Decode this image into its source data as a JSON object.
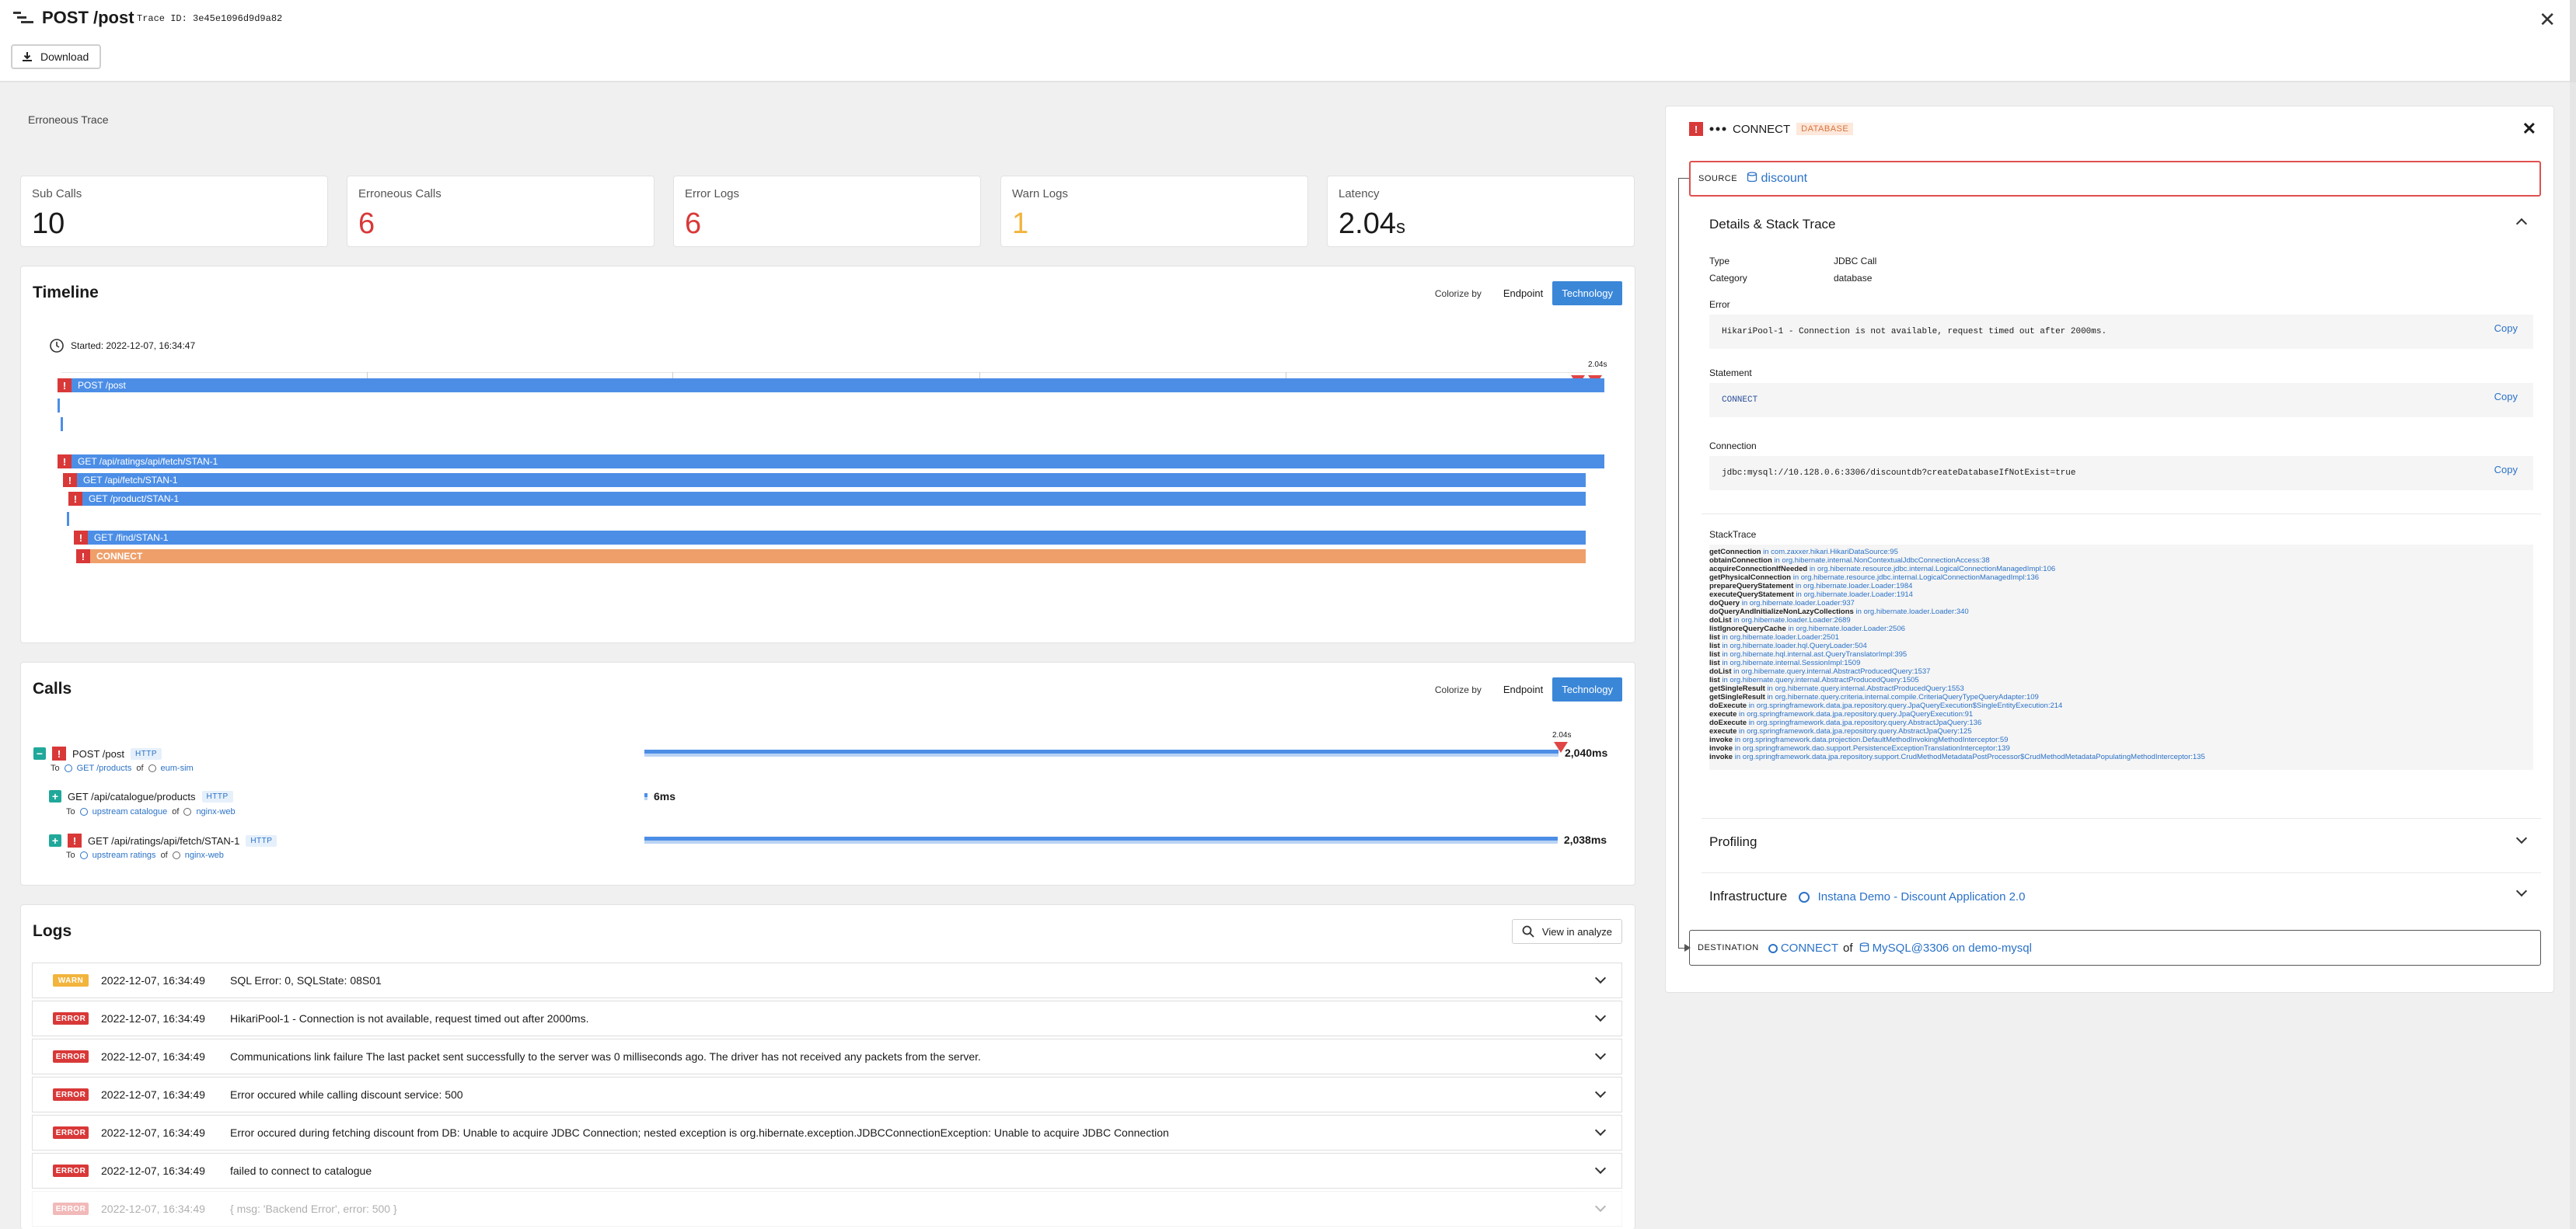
{
  "header": {
    "title": "POST /post",
    "trace_id": "Trace ID: 3e45e1096d9d9a82",
    "download_label": "Download",
    "close_glyph": "✕"
  },
  "main": {
    "erroneous_label": "Erroneous Trace",
    "stats": [
      {
        "label": "Sub Calls",
        "value": "10",
        "color": "#1a1a1a"
      },
      {
        "label": "Erroneous Calls",
        "value": "6",
        "color": "#d93838"
      },
      {
        "label": "Error Logs",
        "value": "6",
        "color": "#d93838"
      },
      {
        "label": "Warn Logs",
        "value": "1",
        "color": "#f2b43c"
      },
      {
        "label": "Latency",
        "value": "2.04",
        "unit": "s",
        "color": "#1a1a1a"
      }
    ],
    "timeline": {
      "title": "Timeline",
      "colorize_label": "Colorize by",
      "option_endpoint": "Endpoint",
      "option_technology": "Technology",
      "started": "Started: 2022-12-07, 16:34:47",
      "end_label": "2.04s",
      "spans": [
        {
          "label": "POST /post",
          "start": 0.0,
          "end": 1.0,
          "error": true,
          "color": "blue"
        },
        {
          "label": "GET /api/ratings/api/fetch/STAN-1",
          "start": 0.0,
          "end": 1.0,
          "error": true,
          "color": "blue"
        },
        {
          "label": "GET /api/fetch/STAN-1",
          "start": 0.002,
          "end": 0.988,
          "error": true,
          "color": "blue"
        },
        {
          "label": "GET /product/STAN-1",
          "start": 0.004,
          "end": 0.988,
          "error": true,
          "color": "blue"
        },
        {
          "label": "GET /find/STAN-1",
          "start": 0.006,
          "end": 0.988,
          "error": true,
          "color": "blue"
        },
        {
          "label": "CONNECT",
          "start": 0.006,
          "end": 0.988,
          "error": true,
          "color": "orange"
        }
      ]
    },
    "calls": {
      "title": "Calls",
      "colorize_label": "Colorize by",
      "option_endpoint": "Endpoint",
      "option_technology": "Technology",
      "end_label": "2.04s",
      "rows": [
        {
          "name": "POST /post",
          "tag": "HTTP",
          "to": "To",
          "target": "GET /products",
          "of": "of",
          "service": "eum-sim",
          "duration": "2,040ms",
          "toggle": "−",
          "error": true,
          "fraction": 1.0
        },
        {
          "name": "GET /api/catalogue/products",
          "tag": "HTTP",
          "to": "To",
          "target": "upstream catalogue",
          "of": "of",
          "service": "nginx-web",
          "duration": "6ms",
          "toggle": "+",
          "error": false,
          "fraction": 0.003
        },
        {
          "name": "GET /api/ratings/api/fetch/STAN-1",
          "tag": "HTTP",
          "to": "To",
          "target": "upstream ratings",
          "of": "of",
          "service": "nginx-web",
          "duration": "2,038ms",
          "toggle": "+",
          "error": true,
          "fraction": 0.999
        }
      ]
    },
    "logs": {
      "title": "Logs",
      "view_label": "View in analyze",
      "rows": [
        {
          "level": "WARN",
          "time": "2022-12-07, 16:34:49",
          "message": "SQL Error: 0, SQLState: 08S01"
        },
        {
          "level": "ERROR",
          "time": "2022-12-07, 16:34:49",
          "message": "HikariPool-1 - Connection is not available, request timed out after 2000ms."
        },
        {
          "level": "ERROR",
          "time": "2022-12-07, 16:34:49",
          "message": "Communications link failure The last packet sent successfully to the server was 0 milliseconds ago. The driver has not received any packets from the server."
        },
        {
          "level": "ERROR",
          "time": "2022-12-07, 16:34:49",
          "message": "Error occured while calling discount service: 500"
        },
        {
          "level": "ERROR",
          "time": "2022-12-07, 16:34:49",
          "message": "Error occured during fetching discount from DB: Unable to acquire JDBC Connection; nested exception is org.hibernate.exception.JDBCConnectionException: Unable to acquire JDBC Connection"
        },
        {
          "level": "ERROR",
          "time": "2022-12-07, 16:34:49",
          "message": "failed to connect to catalogue"
        },
        {
          "level": "ERROR",
          "time": "2022-12-07, 16:34:49",
          "message": "{ msg: 'Backend Error', error: 500 }"
        }
      ]
    }
  },
  "detail": {
    "title": "CONNECT",
    "tag": "DATABASE",
    "close": "✕",
    "source_label": "SOURCE",
    "source_value": "discount",
    "details_title": "Details & Stack Trace",
    "type_key": "Type",
    "type_value": "JDBC Call",
    "category_key": "Category",
    "category_value": "database",
    "error_label": "Error",
    "error_value": "HikariPool-1 - Connection is not available, request timed out after 2000ms.",
    "statement_label": "Statement",
    "statement_value": "CONNECT",
    "connection_label": "Connection",
    "connection_value": "jdbc:mysql://10.128.0.6:3306/discountdb?createDatabaseIfNotExist=true",
    "copy_label": "Copy",
    "stack_label": "StackTrace",
    "stack": [
      {
        "m": "getConnection",
        "p": "in com.zaxxer.hikari.HikariDataSource:95"
      },
      {
        "m": "obtainConnection",
        "p": "in org.hibernate.internal.NonContextualJdbcConnectionAccess:38"
      },
      {
        "m": "acquireConnectionIfNeeded",
        "p": "in org.hibernate.resource.jdbc.internal.LogicalConnectionManagedImpl:106"
      },
      {
        "m": "getPhysicalConnection",
        "p": "in org.hibernate.resource.jdbc.internal.LogicalConnectionManagedImpl:136"
      },
      {
        "m": "prepareQueryStatement",
        "p": "in org.hibernate.loader.Loader:1984"
      },
      {
        "m": "executeQueryStatement",
        "p": "in org.hibernate.loader.Loader:1914"
      },
      {
        "m": "doQuery",
        "p": "in org.hibernate.loader.Loader:937"
      },
      {
        "m": "doQueryAndInitializeNonLazyCollections",
        "p": "in org.hibernate.loader.Loader:340"
      },
      {
        "m": "doList",
        "p": "in org.hibernate.loader.Loader:2689"
      },
      {
        "m": "listIgnoreQueryCache",
        "p": "in org.hibernate.loader.Loader:2506"
      },
      {
        "m": "list",
        "p": "in org.hibernate.loader.Loader:2501"
      },
      {
        "m": "list",
        "p": "in org.hibernate.loader.hql.QueryLoader:504"
      },
      {
        "m": "list",
        "p": "in org.hibernate.hql.internal.ast.QueryTranslatorImpl:395"
      },
      {
        "m": "list",
        "p": "in org.hibernate.internal.SessionImpl:1509"
      },
      {
        "m": "doList",
        "p": "in org.hibernate.query.internal.AbstractProducedQuery:1537"
      },
      {
        "m": "list",
        "p": "in org.hibernate.query.internal.AbstractProducedQuery:1505"
      },
      {
        "m": "getSingleResult",
        "p": "in org.hibernate.query.internal.AbstractProducedQuery:1553"
      },
      {
        "m": "getSingleResult",
        "p": "in org.hibernate.query.criteria.internal.compile.CriteriaQueryTypeQueryAdapter:109"
      },
      {
        "m": "doExecute",
        "p": "in org.springframework.data.jpa.repository.query.JpaQueryExecution$SingleEntityExecution:214"
      },
      {
        "m": "execute",
        "p": "in org.springframework.data.jpa.repository.query.JpaQueryExecution:91"
      },
      {
        "m": "doExecute",
        "p": "in org.springframework.data.jpa.repository.query.AbstractJpaQuery:136"
      },
      {
        "m": "execute",
        "p": "in org.springframework.data.jpa.repository.query.AbstractJpaQuery:125"
      },
      {
        "m": "invoke",
        "p": "in org.springframework.data.projection.DefaultMethodInvokingMethodInterceptor:59"
      },
      {
        "m": "invoke",
        "p": "in org.springframework.dao.support.PersistenceExceptionTranslationInterceptor:139"
      },
      {
        "m": "invoke",
        "p": "in org.springframework.data.jpa.repository.support.CrudMethodMetadataPostProcessor$CrudMethodMetadataPopulatingMethodInterceptor:135"
      }
    ],
    "profiling_title": "Profiling",
    "infra_title": "Infrastructure",
    "infra_value": "Instana Demo - Discount Application 2.0",
    "destination_label": "DESTINATION",
    "destination_call": "CONNECT",
    "destination_of": "of",
    "destination_service": "MySQL@3306 on demo-mysql"
  }
}
